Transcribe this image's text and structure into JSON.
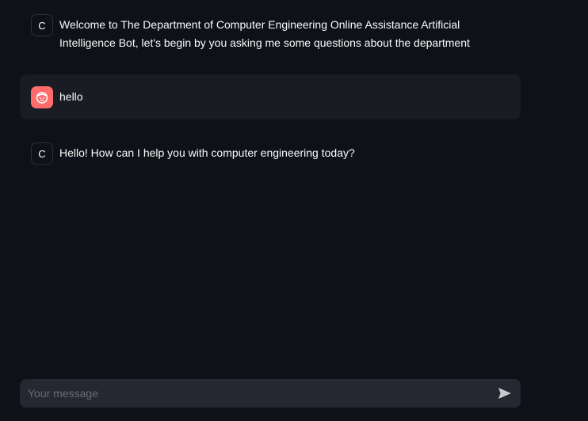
{
  "messages": [
    {
      "role": "assistant",
      "avatar_letter": "C",
      "text": "Welcome to The Department of Computer Engineering Online Assistance Artificial Intelligence Bot, let's begin by you asking me some questions about the department"
    },
    {
      "role": "user",
      "avatar_icon": "user-face-icon",
      "text": "hello"
    },
    {
      "role": "assistant",
      "avatar_letter": "C",
      "text": "Hello! How can I help you with computer engineering today?"
    }
  ],
  "chat_input": {
    "placeholder": "Your message",
    "value": "",
    "send_icon": "send-arrow-icon"
  },
  "colors": {
    "background": "#0e1117",
    "user_bubble": "#1a1c24",
    "user_avatar": "#ff6b6b",
    "input_bg": "#262730",
    "text": "#fafafa"
  }
}
